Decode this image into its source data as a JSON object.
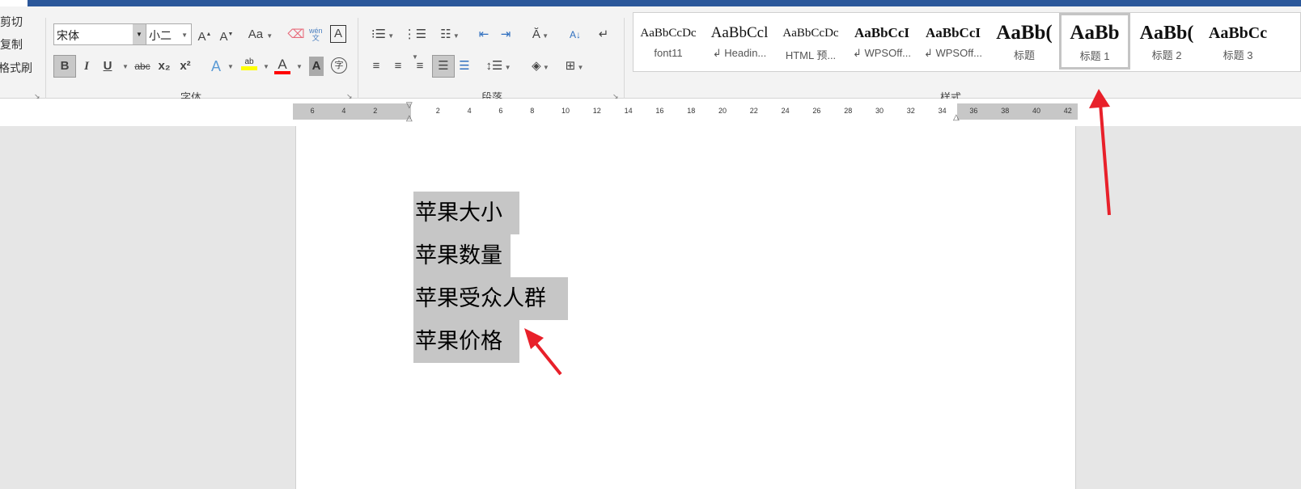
{
  "clipboard": {
    "cut": "剪切",
    "copy": "复制",
    "format_painter": "格式刷"
  },
  "font": {
    "name": "宋体",
    "size": "小二",
    "group_label": "字体",
    "grow": "A",
    "shrink": "A",
    "case": "Aa",
    "bold": "B",
    "italic": "I",
    "underline": "U",
    "strike": "abc",
    "sub": "x₂",
    "sup": "x²",
    "phonetic": "wén",
    "enclose": "字",
    "border_char": "A",
    "effects": "A",
    "highlight": "ab",
    "font_color": "A",
    "shading": "A"
  },
  "paragraph": {
    "group_label": "段落"
  },
  "styles": {
    "group_label": "样式",
    "items": [
      {
        "preview": "AaBbCcDc",
        "name": "font11"
      },
      {
        "preview": "AaBbCcl",
        "name": "↲ Headin..."
      },
      {
        "preview": "AaBbCcDc",
        "name": "HTML 预..."
      },
      {
        "preview": "AaBbCcI",
        "name": "↲ WPSOff..."
      },
      {
        "preview": "AaBbCcI",
        "name": "↲ WPSOff..."
      },
      {
        "preview": "AaBb(",
        "name": "标题"
      },
      {
        "preview": "AaBb",
        "name": "标题 1"
      },
      {
        "preview": "AaBb(",
        "name": "标题 2"
      },
      {
        "preview": "AaBbCc",
        "name": "标题 3"
      }
    ],
    "selected": "标题 1"
  },
  "ruler": {
    "left": [
      "6",
      "4",
      "2"
    ],
    "right": [
      "2",
      "4",
      "6",
      "8",
      "10",
      "12",
      "14",
      "16",
      "18",
      "20",
      "22",
      "24",
      "26",
      "28",
      "30",
      "32",
      "34",
      "36",
      "38",
      "40",
      "42"
    ]
  },
  "document": {
    "lines": [
      "苹果大小",
      "苹果数量",
      "苹果受众人群",
      "苹果价格"
    ]
  },
  "colors": {
    "title_bar": "#2b579a",
    "highlight": "#ffff00",
    "font_color": "#ff0000",
    "arrow": "#e8202a"
  }
}
